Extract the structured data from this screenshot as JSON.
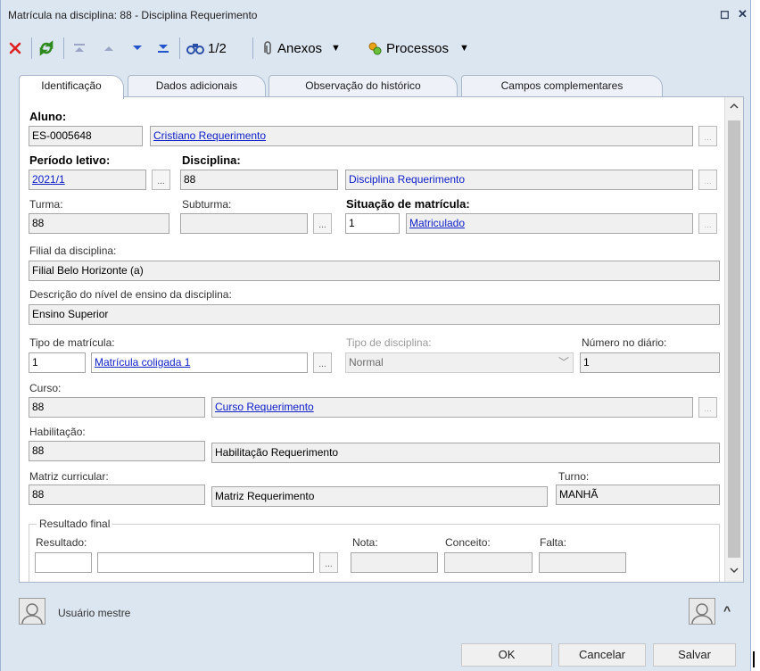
{
  "window": {
    "title": "Matrícula na disciplina: 88 - Disciplina Requerimento",
    "restore_glyph": "◻",
    "close_glyph": "✕"
  },
  "toolbar": {
    "record_indicator": "1/2",
    "attachments_label": "Anexos",
    "processes_label": "Processos",
    "icons": [
      "delete-icon",
      "refresh-icon",
      "first-record-icon",
      "previous-record-icon",
      "next-record-icon",
      "last-record-icon",
      "find-icon",
      "paperclip-icon",
      "processes-icon"
    ],
    "colors": {
      "delete": "#e02020",
      "refresh": "#2f8a1e",
      "nav": "#2255cc"
    }
  },
  "tabs": [
    {
      "label": "Identificação",
      "active": true
    },
    {
      "label": "Dados adicionais",
      "active": false
    },
    {
      "label": "Observação do histórico",
      "active": false
    },
    {
      "label": "Campos complementares",
      "active": false
    }
  ],
  "form": {
    "aluno": {
      "label": "Aluno:",
      "code": "ES-0005648",
      "name": "Cristiano Requerimento"
    },
    "periodo": {
      "label": "Período letivo:",
      "value": "2021/1"
    },
    "disciplina": {
      "label": "Disciplina:",
      "code": "88",
      "name": "Disciplina Requerimento"
    },
    "turma": {
      "label": "Turma:",
      "value": "88"
    },
    "subturma": {
      "label": "Subturma:",
      "value": ""
    },
    "situacao": {
      "label": "Situação de matrícula:",
      "code": "1",
      "name": "Matriculado"
    },
    "filial": {
      "label": "Filial da disciplina:",
      "value": "Filial Belo Horizonte (a)"
    },
    "nivel": {
      "label": "Descrição do nível de ensino da disciplina:",
      "value": "Ensino Superior"
    },
    "tipo_matricula": {
      "label": "Tipo de matrícula:",
      "code": "1",
      "name": "Matrícula coligada 1"
    },
    "tipo_disciplina": {
      "label": "Tipo de disciplina:",
      "value": "Normal"
    },
    "numero_diario": {
      "label": "Número no diário:",
      "value": "1"
    },
    "curso": {
      "label": "Curso:",
      "code": "88",
      "name": "Curso Requerimento"
    },
    "habilitacao": {
      "label": "Habilitação:",
      "code": "88",
      "name": "Habilitação Requerimento"
    },
    "matriz": {
      "label": "Matriz curricular:",
      "code": "88",
      "name": "Matriz Requerimento"
    },
    "turno": {
      "label": "Turno:",
      "value": "MANHÃ"
    },
    "resultado_final": {
      "legend": "Resultado final",
      "resultado_label": "Resultado:",
      "nota_label": "Nota:",
      "conceito_label": "Conceito:",
      "falta_label": "Falta:"
    },
    "lookup_glyph": "..."
  },
  "status": {
    "user": "Usuário mestre",
    "expand_glyph": "^"
  },
  "buttons": {
    "ok": "OK",
    "cancel": "Cancelar",
    "save": "Salvar"
  }
}
